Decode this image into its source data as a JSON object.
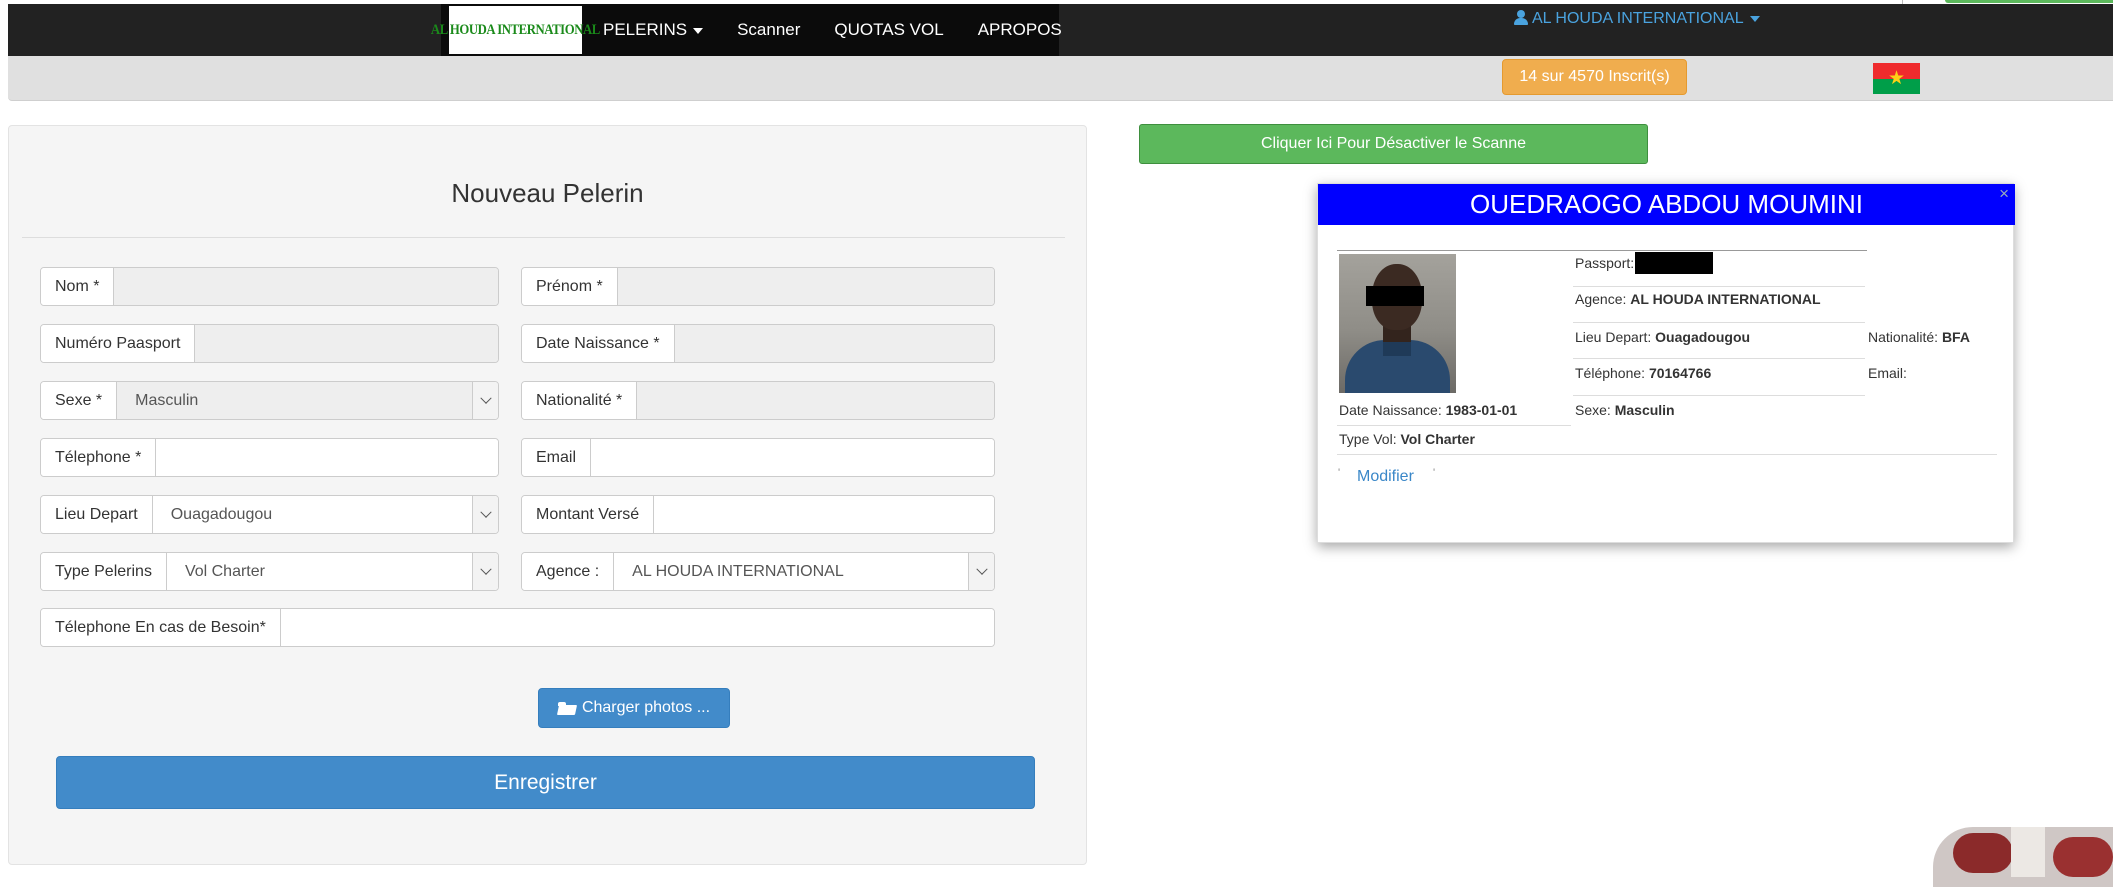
{
  "navbar": {
    "brand": "AL HOUDA INTERNATIONAL",
    "items": [
      {
        "label": "PELERINS",
        "dropdown": true
      },
      {
        "label": "Scanner"
      },
      {
        "label": "QUOTAS VOL"
      },
      {
        "label": "APROPOS"
      }
    ],
    "user": "AL HOUDA INTERNATIONAL"
  },
  "status": {
    "count_badge": "14 sur 4570 Inscrit(s)",
    "flag_icon": "burkina-faso-flag-icon"
  },
  "form": {
    "title": "Nouveau Pelerin",
    "fields": {
      "nom": {
        "label": "Nom *",
        "value": ""
      },
      "prenom": {
        "label": "Prénom *",
        "value": ""
      },
      "numero_passport": {
        "label": "Numéro Paasport",
        "value": ""
      },
      "date_naissance": {
        "label": "Date Naissance *",
        "value": ""
      },
      "sexe": {
        "label": "Sexe *",
        "value": "Masculin"
      },
      "nationalite": {
        "label": "Nationalité *",
        "value": ""
      },
      "telephone": {
        "label": "Télephone *",
        "value": ""
      },
      "email": {
        "label": "Email",
        "value": ""
      },
      "lieu_depart": {
        "label": "Lieu Depart",
        "value": "Ouagadougou"
      },
      "montant_verse": {
        "label": "Montant Versé",
        "value": ""
      },
      "type_pelerins": {
        "label": "Type Pelerins",
        "value": "Vol Charter"
      },
      "agence": {
        "label": "Agence :",
        "value": "AL HOUDA INTERNATIONAL"
      },
      "telephone_besoin": {
        "label": "Télephone En cas de Besoin*",
        "value": ""
      }
    },
    "photo_button": "Charger photos ...",
    "save_button": "Enregistrer"
  },
  "scan_button": "Cliquer Ici Pour Désactiver le Scanne",
  "card": {
    "name": "OUEDRAOGO ABDOU MOUMINI",
    "close": "×",
    "passport_label": "Passport:",
    "agence_label": "Agence:",
    "agence_value": "AL HOUDA INTERNATIONAL",
    "lieu_label": "Lieu Depart:",
    "lieu_value": "Ouagadougou",
    "nationalite_label": "Nationalité:",
    "nationalite_value": "BFA",
    "telephone_label": "Téléphone:",
    "telephone_value": "70164766",
    "email_label": "Email:",
    "email_value": "",
    "naissance_label": "Date Naissance:",
    "naissance_value": "1983-01-01",
    "sexe_label": "Sexe:",
    "sexe_value": "Masculin",
    "typevol_label": "Type Vol:",
    "typevol_value": "Vol Charter",
    "modifier": "Modifier",
    "tick": "'"
  },
  "colors": {
    "navbar": "#222222",
    "primary": "#428bca",
    "success": "#5cb85c",
    "warning": "#f0ad4e",
    "card_header": "#0000ff",
    "link": "#4aa3df"
  }
}
